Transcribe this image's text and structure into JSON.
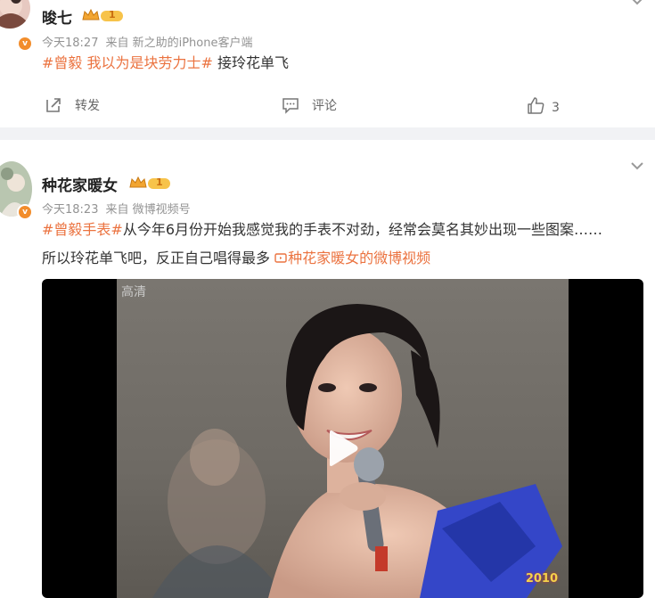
{
  "post1": {
    "username": "晙七",
    "level": "1",
    "verified_mark": "v",
    "time": "今天18:27",
    "source": "来自 新之助的iPhone客户端",
    "hashtag": "#曾毅 我以为是块劳力士#",
    "text": " 接玲花单飞",
    "actions": {
      "repost_label": "转发",
      "comment_label": "评论",
      "like_count": "3"
    }
  },
  "post2": {
    "username": "种花家暖女",
    "level": "1",
    "verified_mark": "v",
    "time": "今天18:23",
    "source": "来自 微博视频号",
    "hashtag": "#曾毅手表#",
    "text": "从今年6月份开始我感觉我的手表不对劲，经常会莫名其妙出现一些图案……所以玲花单飞吧，反正自己唱得最多 ",
    "video_link": "种花家暖女的微博视频",
    "video": {
      "hd_label": "高清",
      "logo_text": "2010"
    }
  },
  "icons": [
    "chevron-down-icon",
    "crown-icon",
    "repost-icon",
    "comment-icon",
    "like-icon",
    "video-link-icon",
    "play-icon"
  ],
  "colors": {
    "accent": "#eb7340",
    "badge": "#f28d2c",
    "separator": "#f1f2f5",
    "meta": "#939393"
  }
}
